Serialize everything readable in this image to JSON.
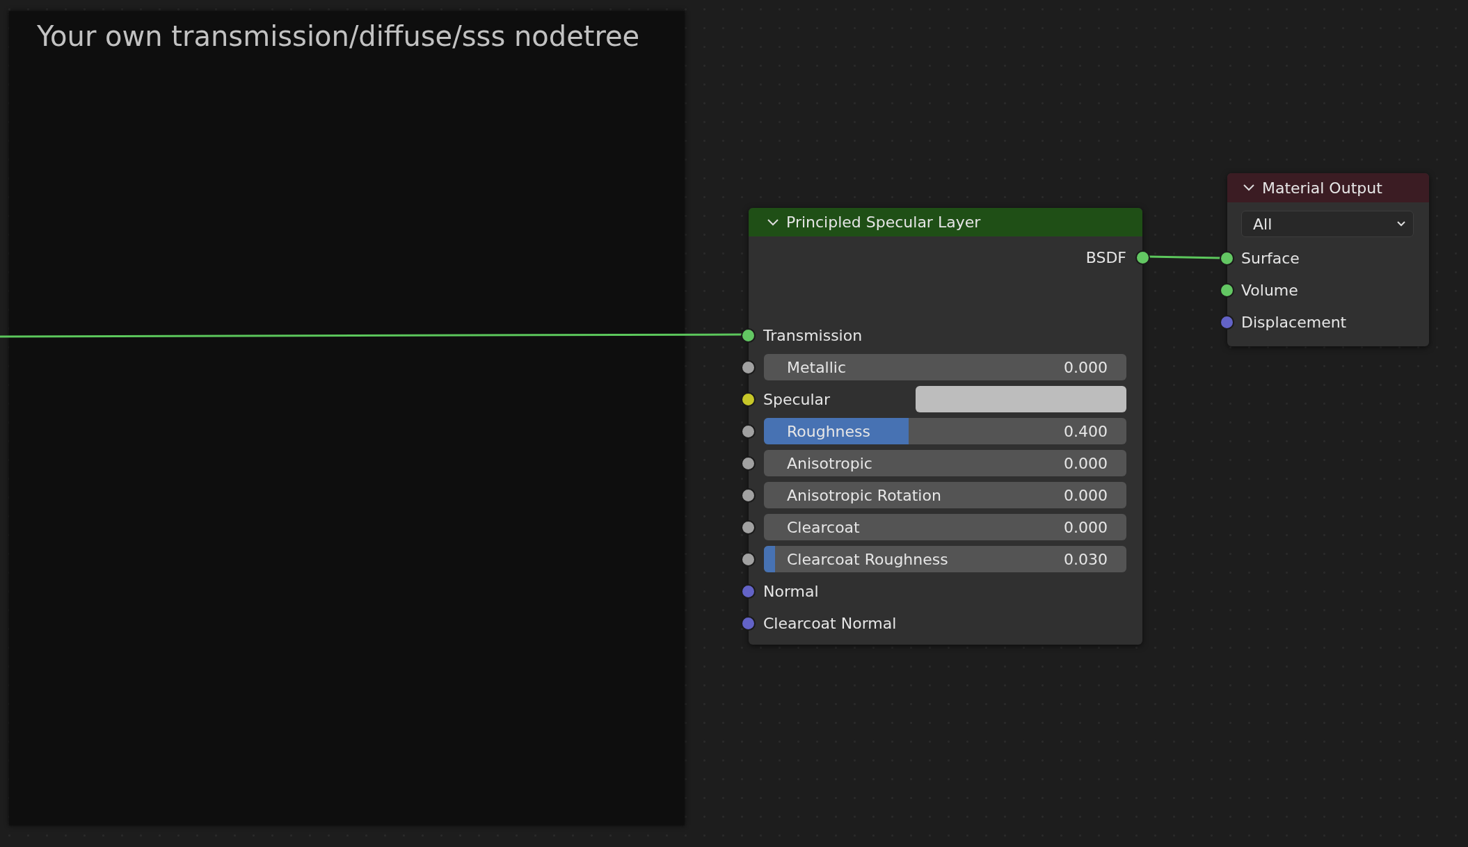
{
  "frame": {
    "label": "Your own transmission/diffuse/sss nodetree"
  },
  "nodes": [
    {
      "kind": "shader",
      "title": "Principled Specular Layer",
      "color": "#1f4f16",
      "outputs": [
        {
          "label": "BSDF",
          "color": "#63c763"
        }
      ],
      "inputs": [
        {
          "kind": "socket",
          "label": "Transmission",
          "color": "#63c763"
        },
        {
          "kind": "slider",
          "label": "Metallic",
          "value": "0.000",
          "level": 0,
          "color": "#a1a1a1"
        },
        {
          "kind": "swatch",
          "label": "Specular",
          "color": "#c7c729",
          "swatch": {
            "color": "#bdbdbd"
          }
        },
        {
          "kind": "slider",
          "label": "Roughness",
          "value": "0.400",
          "level": 0.4,
          "color": "#a1a1a1"
        },
        {
          "kind": "slider",
          "label": "Anisotropic",
          "value": "0.000",
          "level": 0,
          "color": "#a1a1a1"
        },
        {
          "kind": "slider",
          "label": "Anisotropic Rotation",
          "value": "0.000",
          "level": 0,
          "color": "#a1a1a1"
        },
        {
          "kind": "slider",
          "label": "Clearcoat",
          "value": "0.000",
          "level": 0,
          "color": "#a1a1a1"
        },
        {
          "kind": "slider",
          "label": "Clearcoat Roughness",
          "value": "0.030",
          "level": 0.03,
          "color": "#a1a1a1"
        },
        {
          "kind": "socket",
          "label": "Normal",
          "color": "#6363c7"
        },
        {
          "kind": "socket",
          "label": "Clearcoat Normal",
          "color": "#6363c7"
        }
      ]
    },
    {
      "kind": "output",
      "title": "Material Output",
      "color": "#3b1c23",
      "target": "All",
      "inputs": [
        {
          "kind": "socket",
          "label": "Surface",
          "color": "#63c763"
        },
        {
          "kind": "socket",
          "label": "Volume",
          "color": "#63c763"
        },
        {
          "kind": "socket",
          "label": "Displacement",
          "color": "#6363c7"
        }
      ]
    }
  ]
}
